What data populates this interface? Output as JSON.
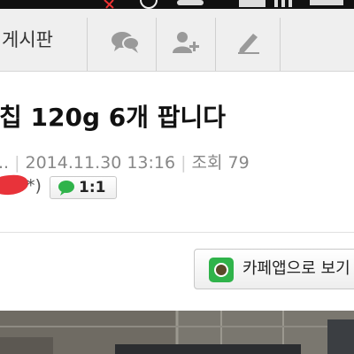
{
  "toolbar": {
    "title": "게시판",
    "buttons": [
      {
        "icon": "chat-bubbles-icon"
      },
      {
        "icon": "add-user-icon"
      },
      {
        "icon": "pencil-icon"
      }
    ]
  },
  "post": {
    "title": "칩 120g 6개 팝니다",
    "meta": {
      "author": "..",
      "date": "2014.11.30 13:16",
      "views": "조회 79"
    },
    "author_suffix": "*)",
    "chat_button_label": "1:1",
    "open_app_label": "카페앱으로 보기"
  },
  "colors": {
    "toolbar_bg": "#efefef",
    "icon_gray": "#9a9a9a",
    "accent_green": "#2fb34a",
    "scribble_red": "#e8333a"
  }
}
